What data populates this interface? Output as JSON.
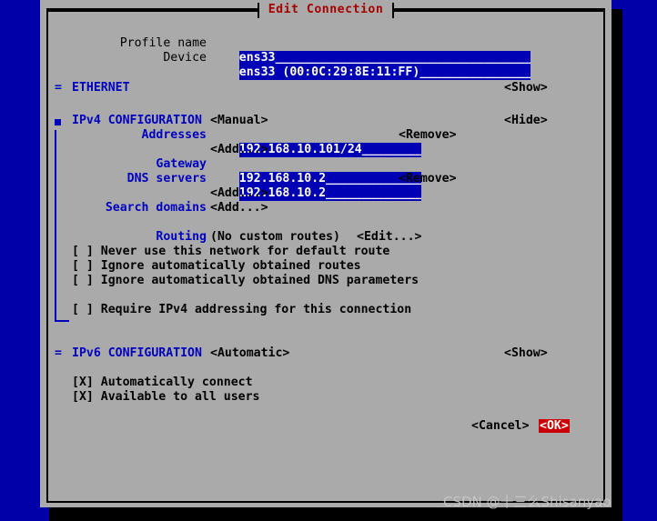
{
  "window": {
    "title": "Edit Connection",
    "title_color": "#a80000",
    "background_color": "#0000a8",
    "dialog_color": "#aaaaaa"
  },
  "form": {
    "profile_name": {
      "label": "Profile name",
      "value": "ens33",
      "fill": "____________________________________________"
    },
    "device": {
      "label": "Device",
      "value": "ens33 (00:0C:29:8E:11:FF)",
      "fill": "___________________"
    }
  },
  "sections": {
    "ethernet": {
      "marker": "=",
      "label": "ETHERNET",
      "toggle": "<Show>"
    },
    "ipv4": {
      "marker": "square",
      "label": "IPv4 CONFIGURATION",
      "mode": "<Manual>",
      "toggle": "<Hide>",
      "addresses": {
        "label": "Addresses",
        "value": "192.168.10.101/24",
        "fill": "_________",
        "remove": "<Remove>",
        "add": "<Add...>"
      },
      "gateway": {
        "label": "Gateway",
        "value": "192.168.10.2",
        "fill": "______________"
      },
      "dns_servers": {
        "label": "DNS servers",
        "value": "192.168.10.2",
        "fill": "______________",
        "remove": "<Remove>",
        "add": "<Add...>"
      },
      "search_domains": {
        "label": "Search domains",
        "add": "<Add...>"
      },
      "routing": {
        "label": "Routing",
        "value": "(No custom routes)",
        "edit": "<Edit...>"
      },
      "checkboxes": [
        {
          "box": "[ ]",
          "label": "Never use this network for default route",
          "checked": false
        },
        {
          "box": "[ ]",
          "label": "Ignore automatically obtained routes",
          "checked": false
        },
        {
          "box": "[ ]",
          "label": "Ignore automatically obtained DNS parameters",
          "checked": false
        }
      ],
      "require_ipv4": {
        "box": "[ ]",
        "label": "Require IPv4 addressing for this connection",
        "checked": false
      }
    },
    "ipv6": {
      "marker": "=",
      "label": "IPv6 CONFIGURATION",
      "mode": "<Automatic>",
      "toggle": "<Show>"
    }
  },
  "global_options": [
    {
      "box": "[X]",
      "label": "Automatically connect",
      "checked": true
    },
    {
      "box": "[X]",
      "label": "Available to all users",
      "checked": true
    }
  ],
  "buttons": {
    "cancel": "<Cancel>",
    "ok": "<OK>",
    "ok_focused": true,
    "ok_color": "#cc0000"
  },
  "watermark": {
    "text": "CSDN @十三么Shisanyao"
  }
}
